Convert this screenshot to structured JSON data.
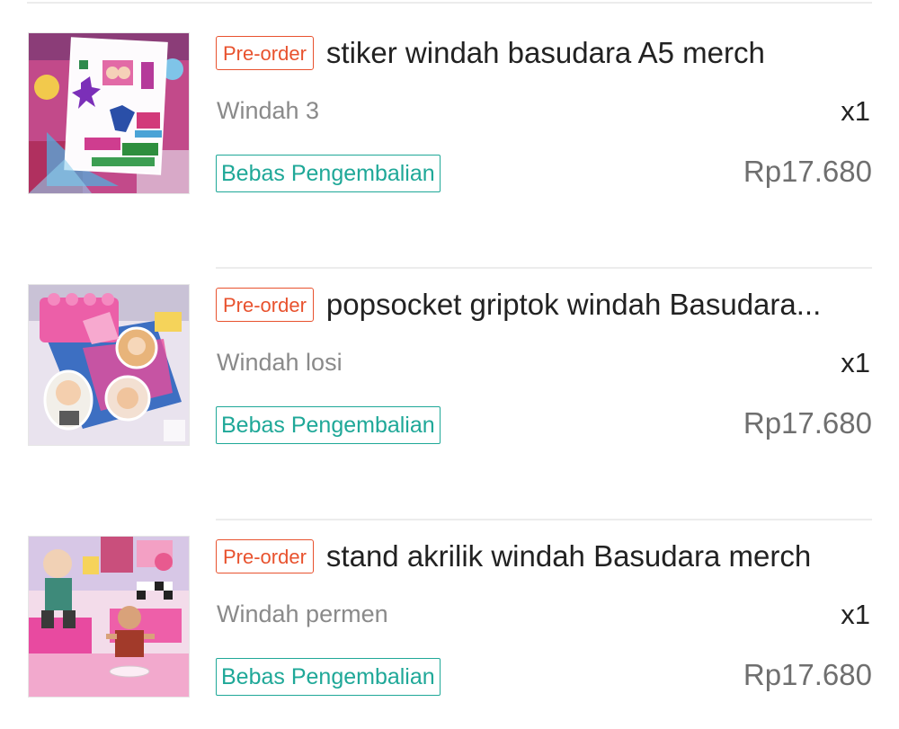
{
  "items": [
    {
      "badge": "Pre-order",
      "name": "stiker windah basudara A5 merch",
      "variant": "Windah 3",
      "quantity": "x1",
      "return_label": "Bebas Pengembalian",
      "price": "Rp17.680",
      "image_desc": "sticker sheet"
    },
    {
      "badge": "Pre-order",
      "name": "popsocket griptok windah Basudara...",
      "variant": "Windah losi",
      "quantity": "x1",
      "return_label": "Bebas Pengembalian",
      "price": "Rp17.680",
      "image_desc": "popsocket grip"
    },
    {
      "badge": "Pre-order",
      "name": "stand akrilik windah Basudara merch",
      "variant": "Windah permen",
      "quantity": "x1",
      "return_label": "Bebas Pengembalian",
      "price": "Rp17.680",
      "image_desc": "acrylic stand"
    }
  ],
  "colors": {
    "preorder": "#e8522e",
    "return_badge": "#1fa898",
    "price": "#6f6f6f",
    "variant": "#8a8a8a",
    "divider": "#ececec"
  }
}
